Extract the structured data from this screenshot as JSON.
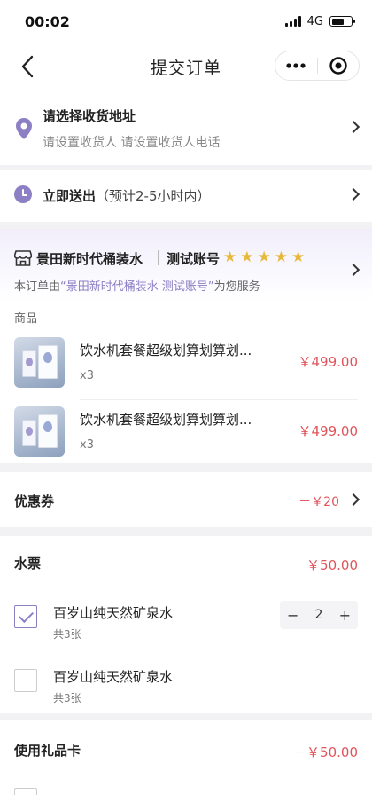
{
  "status_bar": {
    "time": "00:02",
    "network": "4G"
  },
  "nav": {
    "title": "提交订单"
  },
  "address": {
    "title": "请选择收货地址",
    "subtitle": "请设置收货人   请设置收货人电话"
  },
  "delivery": {
    "title": "立即送出",
    "eta": "（预计2-5小时内）"
  },
  "store": {
    "name": "景田新时代桶装水",
    "account": "测试账号",
    "rating": 5,
    "note_prefix": "本订单由",
    "note_highlight": "“景田新时代桶装水 测试账号”",
    "note_suffix": "为您服务",
    "goods_label": "商品",
    "products": [
      {
        "name": "饮水机套餐超级划算划算划...",
        "qty": "x3",
        "price": "￥499.00"
      },
      {
        "name": "饮水机套餐超级划算划算划...",
        "qty": "x3",
        "price": "￥499.00"
      }
    ]
  },
  "coupon": {
    "label": "优惠券",
    "value": "－￥20"
  },
  "water_ticket": {
    "label": "水票",
    "total": "￥50.00",
    "items": [
      {
        "name": "百岁山纯天然矿泉水",
        "count": "共3张",
        "checked": true,
        "quantity": "2"
      },
      {
        "name": "百岁山纯天然矿泉水",
        "count": "共3张",
        "checked": false
      }
    ]
  },
  "gift_card": {
    "label": "使用礼品卡",
    "value": "－￥50.00"
  },
  "colors": {
    "accent": "#8d7fc4",
    "price": "#e0555b",
    "star": "#e8b83a"
  }
}
